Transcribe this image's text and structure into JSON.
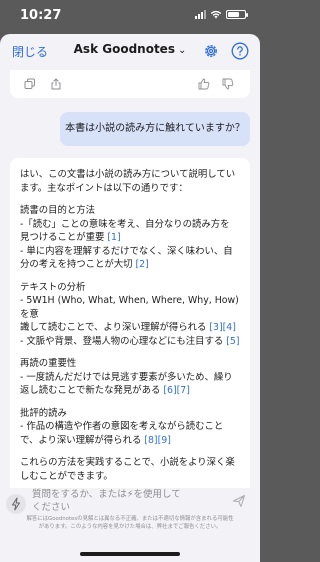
{
  "status_bar": {
    "time": "10:27"
  },
  "header": {
    "close_label": "閉じる",
    "title": "Ask Goodnotes",
    "title_chevron": "⌄"
  },
  "user_message": "本書は小説の読み方に触れていますか？",
  "answer": {
    "intro_1": "はい、この文書は小説の読み方について説明してい",
    "intro_2": "ます。主なポイントは以下の通りです：",
    "s1_title": "読書の目的と方法",
    "s1_l1": "-「読む」ことの意味を考え、自分なりの読み方を",
    "s1_l2": "見つけることが重要",
    "s1_c1": "[1]",
    "s1_l3": "- 単に内容を理解するだけでなく、深く味わい、自",
    "s1_l4": "分の考えを持つことが大切",
    "s1_c2": "[2]",
    "s2_title": "テキストの分析",
    "s2_l1": "- 5W1H (Who, What, When, Where, Why, How) を意",
    "s2_l2": "識して読むことで、より深い理解が得られる",
    "s2_c1": "[3][4]",
    "s2_l3": "- 文脈や背景、登場人物の心理などにも注目する",
    "s2_c2": "[5]",
    "s3_title": "再読の重要性",
    "s3_l1": "- 一度読んだだけでは見逃す要素が多いため、繰り",
    "s3_l2": "返し読むことで新たな発見がある",
    "s3_c1": "[6][7]",
    "s4_title": "批評的読み",
    "s4_l1": "- 作品の構造や作者の意図を考えながら読むこと",
    "s4_l2": "で、より深い理解が得られる",
    "s4_c1": "[8][9]",
    "outro_1": "これらの方法を実践することで、小説をより深く楽",
    "outro_2": "しむことができます。"
  },
  "input": {
    "placeholder_1": "質問をするか、または⚡を使用して",
    "placeholder_2": "ください"
  },
  "disclaimer_1": "解答にはGoodnotesの見解とは異なる不正確、または不適切な情報が含まれる可能性",
  "disclaimer_2": "があります。このような内容を見かけた場合は、弊社までご報告ください。",
  "colors": {
    "accent": "#2f6fdb",
    "user_bubble": "#d7e2f9",
    "sheet_bg": "#f2f2f7"
  }
}
